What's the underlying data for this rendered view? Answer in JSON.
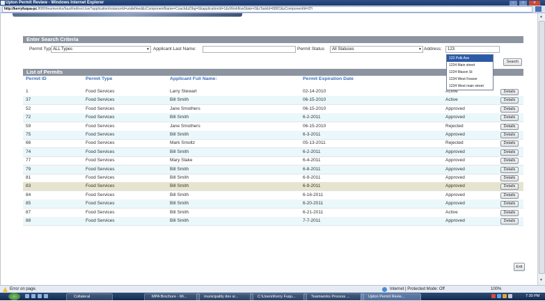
{
  "window": {
    "title": "Upton Permit Review - Windows Internet Explorer",
    "url_host": "http://kerryfuqua-pc",
    "url_rest": ":8080/teamworks/fauxRedirect.lsw?applicationInstanceId=undefined&zComponentName=Coach&zDbg=0&applicationId=1&zWorkflowState=2&zTaskId=t5801&zComponentId=3Ti"
  },
  "search": {
    "header": "Enter Search Criteria",
    "permit_type_label": "Permit Type",
    "permit_type_value": "ALL Types",
    "last_name_label": "Applicant Last Name:",
    "last_name_value": "",
    "status_label": "Permit Status",
    "status_value": "All Statuses",
    "address_label": "Address:",
    "address_value": "123",
    "search_button": "Search",
    "autocomplete": [
      "123 Polk Ave",
      "1234 Main street",
      "1234 Mason St",
      "1234 West Feaver",
      "1234 West main street"
    ]
  },
  "list": {
    "header": "List of Permits",
    "columns": [
      "Permit ID",
      "Permit Type",
      "Applicant Full Name:",
      "Permit Expiration Date"
    ],
    "details_label": "Details",
    "rows": [
      {
        "id": "1",
        "type": "Food Services",
        "name": "Larry Stewart",
        "date": "02-14-2010",
        "status": "Active"
      },
      {
        "id": "37",
        "type": "Food Services",
        "name": "Bill Smith",
        "date": "06-15-2010",
        "status": "Active"
      },
      {
        "id": "52",
        "type": "Food Services",
        "name": "Jane Smothers",
        "date": "06-15-2010",
        "status": "Approved"
      },
      {
        "id": "72",
        "type": "Food Services",
        "name": "Bill Smith",
        "date": "6-2-2011",
        "status": "Approved"
      },
      {
        "id": "59",
        "type": "Food Services",
        "name": "Jane Smothers",
        "date": "06-15-2010",
        "status": "Rejected"
      },
      {
        "id": "75",
        "type": "Food Services",
        "name": "Bill Smith",
        "date": "6-3-2011",
        "status": "Approved"
      },
      {
        "id": "66",
        "type": "Food Services",
        "name": "Mark Smoltz",
        "date": "05-13-2011",
        "status": "Rejected"
      },
      {
        "id": "74",
        "type": "Food Services",
        "name": "Bill Smith",
        "date": "6-2-2011",
        "status": "Approved"
      },
      {
        "id": "77",
        "type": "Food Services",
        "name": "Mary Slake",
        "date": "6-4-2011",
        "status": "Approved"
      },
      {
        "id": "79",
        "type": "Food Services",
        "name": "Bill Smith",
        "date": "6-8-2011",
        "status": "Approved"
      },
      {
        "id": "81",
        "type": "Food Services",
        "name": "Bill Smith",
        "date": "6-9-2011",
        "status": "Approved"
      },
      {
        "id": "83",
        "type": "Food Services",
        "name": "Bill Smith",
        "date": "6-9-2011",
        "status": "Approved"
      },
      {
        "id": "84",
        "type": "Food Services",
        "name": "Bill Smith",
        "date": "6-16-2011",
        "status": "Approved"
      },
      {
        "id": "85",
        "type": "Food Services",
        "name": "Bill Smith",
        "date": "6-20-2011",
        "status": "Approved"
      },
      {
        "id": "87",
        "type": "Food Services",
        "name": "Bill Smith",
        "date": "6-21-2011",
        "status": "Active"
      },
      {
        "id": "88",
        "type": "Food Services",
        "name": "Bill Smith",
        "date": "7-7-2011",
        "status": "Approved"
      }
    ],
    "exit_button": "Exit"
  },
  "statusbar": {
    "error": "Error on page.",
    "zone": "Internet | Protected Mode: Off",
    "zoom": "100%"
  },
  "taskbar": {
    "tasks": [
      "Collateral",
      "MPA Brochure - Mi...",
      "municipality dev sr...",
      "C:\\Users\\Kerry Fuqu...",
      "Teamworks Process ...",
      "Upton Permit Revie..."
    ],
    "clock": "7:30 PM"
  },
  "colors": {
    "section_header": "#8c949f",
    "column_header": "#3b6fb8",
    "row_alt": "#eaf7fb",
    "row_highlight": "#e6e4cf",
    "autocomplete_selected": "#2d5aa8"
  },
  "icons": [
    "ie-icon",
    "minimize-icon",
    "maximize-icon",
    "close-icon",
    "warning-icon",
    "globe-icon",
    "start-orb-icon"
  ]
}
